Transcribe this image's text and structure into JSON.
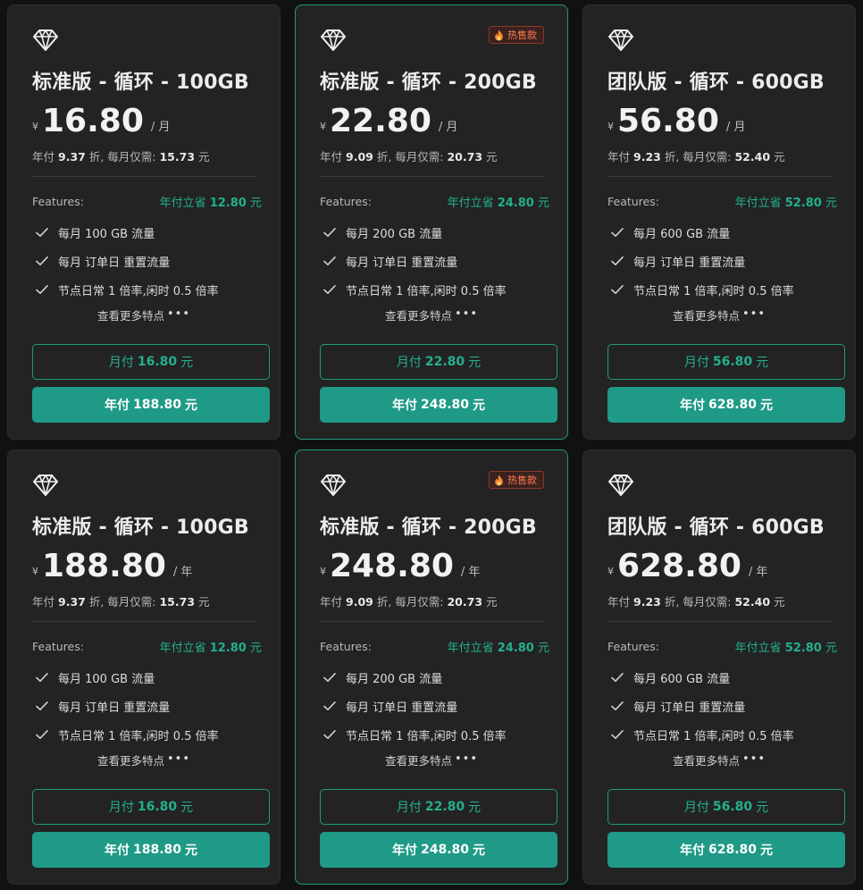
{
  "colors": {
    "accent": "#1e9a86",
    "hot": "#ff7a4e",
    "card_bg": "#232324",
    "page_bg": "#111112"
  },
  "icons": {
    "plan": "diamond-icon",
    "hot": "flame-icon",
    "feature": "check-icon"
  },
  "cards": [
    {
      "hot": false,
      "hot_label": "",
      "title": "标准版 - 循环 - 100GB",
      "currency": "¥",
      "amount": "16.80",
      "period": "/ 月",
      "note_prefix": "年付",
      "discount": "9.37",
      "note_mid": "折, 每月仅需:",
      "monthly_equiv": "15.73",
      "unit": "元",
      "features_label": "Features:",
      "save_prefix": "年付立省",
      "save_amount": "12.80",
      "save_unit": "元",
      "features": [
        "每月 100 GB 流量",
        "每月 订单日 重置流量",
        "节点日常 1 倍率,闲时 0.5 倍率"
      ],
      "more": "查看更多特点",
      "dots": "•••",
      "btn_month_prefix": "月付",
      "btn_month_amount": "16.80",
      "btn_month_unit": "元",
      "btn_year_prefix": "年付",
      "btn_year_amount": "188.80",
      "btn_year_unit": "元"
    },
    {
      "hot": true,
      "hot_label": "热售款",
      "title": "标准版 - 循环 - 200GB",
      "currency": "¥",
      "amount": "22.80",
      "period": "/ 月",
      "note_prefix": "年付",
      "discount": "9.09",
      "note_mid": "折, 每月仅需:",
      "monthly_equiv": "20.73",
      "unit": "元",
      "features_label": "Features:",
      "save_prefix": "年付立省",
      "save_amount": "24.80",
      "save_unit": "元",
      "features": [
        "每月 200 GB 流量",
        "每月 订单日 重置流量",
        "节点日常 1 倍率,闲时 0.5 倍率"
      ],
      "more": "查看更多特点",
      "dots": "•••",
      "btn_month_prefix": "月付",
      "btn_month_amount": "22.80",
      "btn_month_unit": "元",
      "btn_year_prefix": "年付",
      "btn_year_amount": "248.80",
      "btn_year_unit": "元"
    },
    {
      "hot": false,
      "hot_label": "",
      "title": "团队版 - 循环 - 600GB",
      "currency": "¥",
      "amount": "56.80",
      "period": "/ 月",
      "note_prefix": "年付",
      "discount": "9.23",
      "note_mid": "折, 每月仅需:",
      "monthly_equiv": "52.40",
      "unit": "元",
      "features_label": "Features:",
      "save_prefix": "年付立省",
      "save_amount": "52.80",
      "save_unit": "元",
      "features": [
        "每月 600 GB 流量",
        "每月 订单日 重置流量",
        "节点日常 1 倍率,闲时 0.5 倍率"
      ],
      "more": "查看更多特点",
      "dots": "•••",
      "btn_month_prefix": "月付",
      "btn_month_amount": "56.80",
      "btn_month_unit": "元",
      "btn_year_prefix": "年付",
      "btn_year_amount": "628.80",
      "btn_year_unit": "元"
    },
    {
      "hot": false,
      "hot_label": "",
      "title": "标准版 - 循环 - 100GB",
      "currency": "¥",
      "amount": "188.80",
      "period": "/ 年",
      "note_prefix": "年付",
      "discount": "9.37",
      "note_mid": "折, 每月仅需:",
      "monthly_equiv": "15.73",
      "unit": "元",
      "features_label": "Features:",
      "save_prefix": "年付立省",
      "save_amount": "12.80",
      "save_unit": "元",
      "features": [
        "每月 100 GB 流量",
        "每月 订单日 重置流量",
        "节点日常 1 倍率,闲时 0.5 倍率"
      ],
      "more": "查看更多特点",
      "dots": "•••",
      "btn_month_prefix": "月付",
      "btn_month_amount": "16.80",
      "btn_month_unit": "元",
      "btn_year_prefix": "年付",
      "btn_year_amount": "188.80",
      "btn_year_unit": "元"
    },
    {
      "hot": true,
      "hot_label": "热售款",
      "title": "标准版 - 循环 - 200GB",
      "currency": "¥",
      "amount": "248.80",
      "period": "/ 年",
      "note_prefix": "年付",
      "discount": "9.09",
      "note_mid": "折, 每月仅需:",
      "monthly_equiv": "20.73",
      "unit": "元",
      "features_label": "Features:",
      "save_prefix": "年付立省",
      "save_amount": "24.80",
      "save_unit": "元",
      "features": [
        "每月 200 GB 流量",
        "每月 订单日 重置流量",
        "节点日常 1 倍率,闲时 0.5 倍率"
      ],
      "more": "查看更多特点",
      "dots": "•••",
      "btn_month_prefix": "月付",
      "btn_month_amount": "22.80",
      "btn_month_unit": "元",
      "btn_year_prefix": "年付",
      "btn_year_amount": "248.80",
      "btn_year_unit": "元"
    },
    {
      "hot": false,
      "hot_label": "",
      "title": "团队版 - 循环 - 600GB",
      "currency": "¥",
      "amount": "628.80",
      "period": "/ 年",
      "note_prefix": "年付",
      "discount": "9.23",
      "note_mid": "折, 每月仅需:",
      "monthly_equiv": "52.40",
      "unit": "元",
      "features_label": "Features:",
      "save_prefix": "年付立省",
      "save_amount": "52.80",
      "save_unit": "元",
      "features": [
        "每月 600 GB 流量",
        "每月 订单日 重置流量",
        "节点日常 1 倍率,闲时 0.5 倍率"
      ],
      "more": "查看更多特点",
      "dots": "•••",
      "btn_month_prefix": "月付",
      "btn_month_amount": "56.80",
      "btn_month_unit": "元",
      "btn_year_prefix": "年付",
      "btn_year_amount": "628.80",
      "btn_year_unit": "元"
    }
  ]
}
